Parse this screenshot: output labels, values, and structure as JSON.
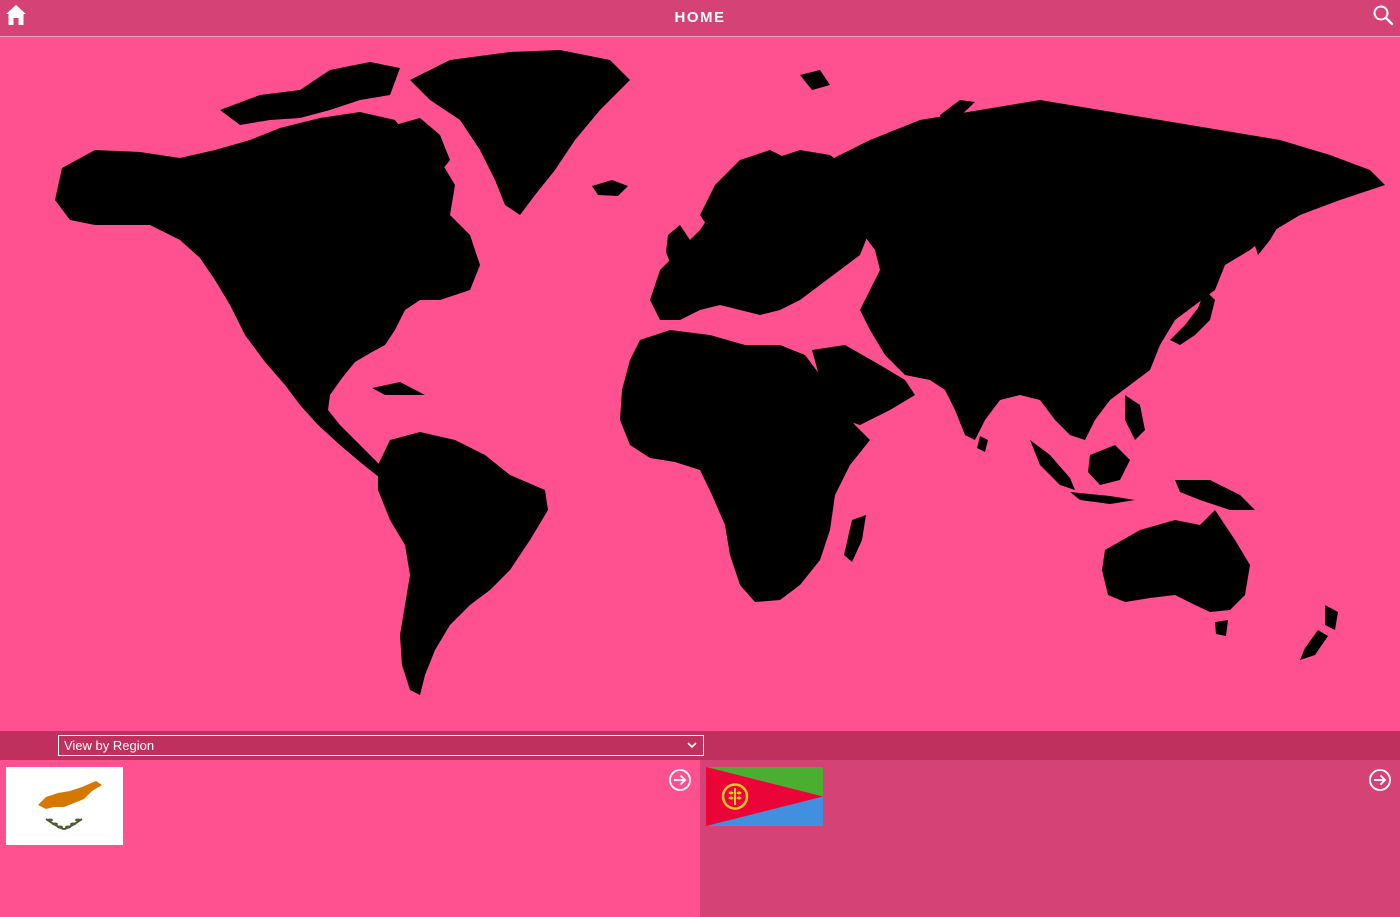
{
  "header": {
    "title": "HOME",
    "home_icon": "home-icon",
    "search_icon": "search-icon"
  },
  "map": {
    "ocean_color": "#ff5090",
    "land_color": "#000000"
  },
  "filter": {
    "selected": "View by Region"
  },
  "cards": [
    {
      "flag_icon": "cyprus-flag-icon",
      "action_icon": "arrow-right-circle-icon"
    },
    {
      "flag_icon": "eritrea-flag-icon",
      "action_icon": "arrow-right-circle-icon"
    }
  ],
  "colors": {
    "header_bg": "#d44276",
    "filter_bg": "#c0305f",
    "panel_left_bg": "#ff5090",
    "panel_right_bg": "#d44276"
  }
}
